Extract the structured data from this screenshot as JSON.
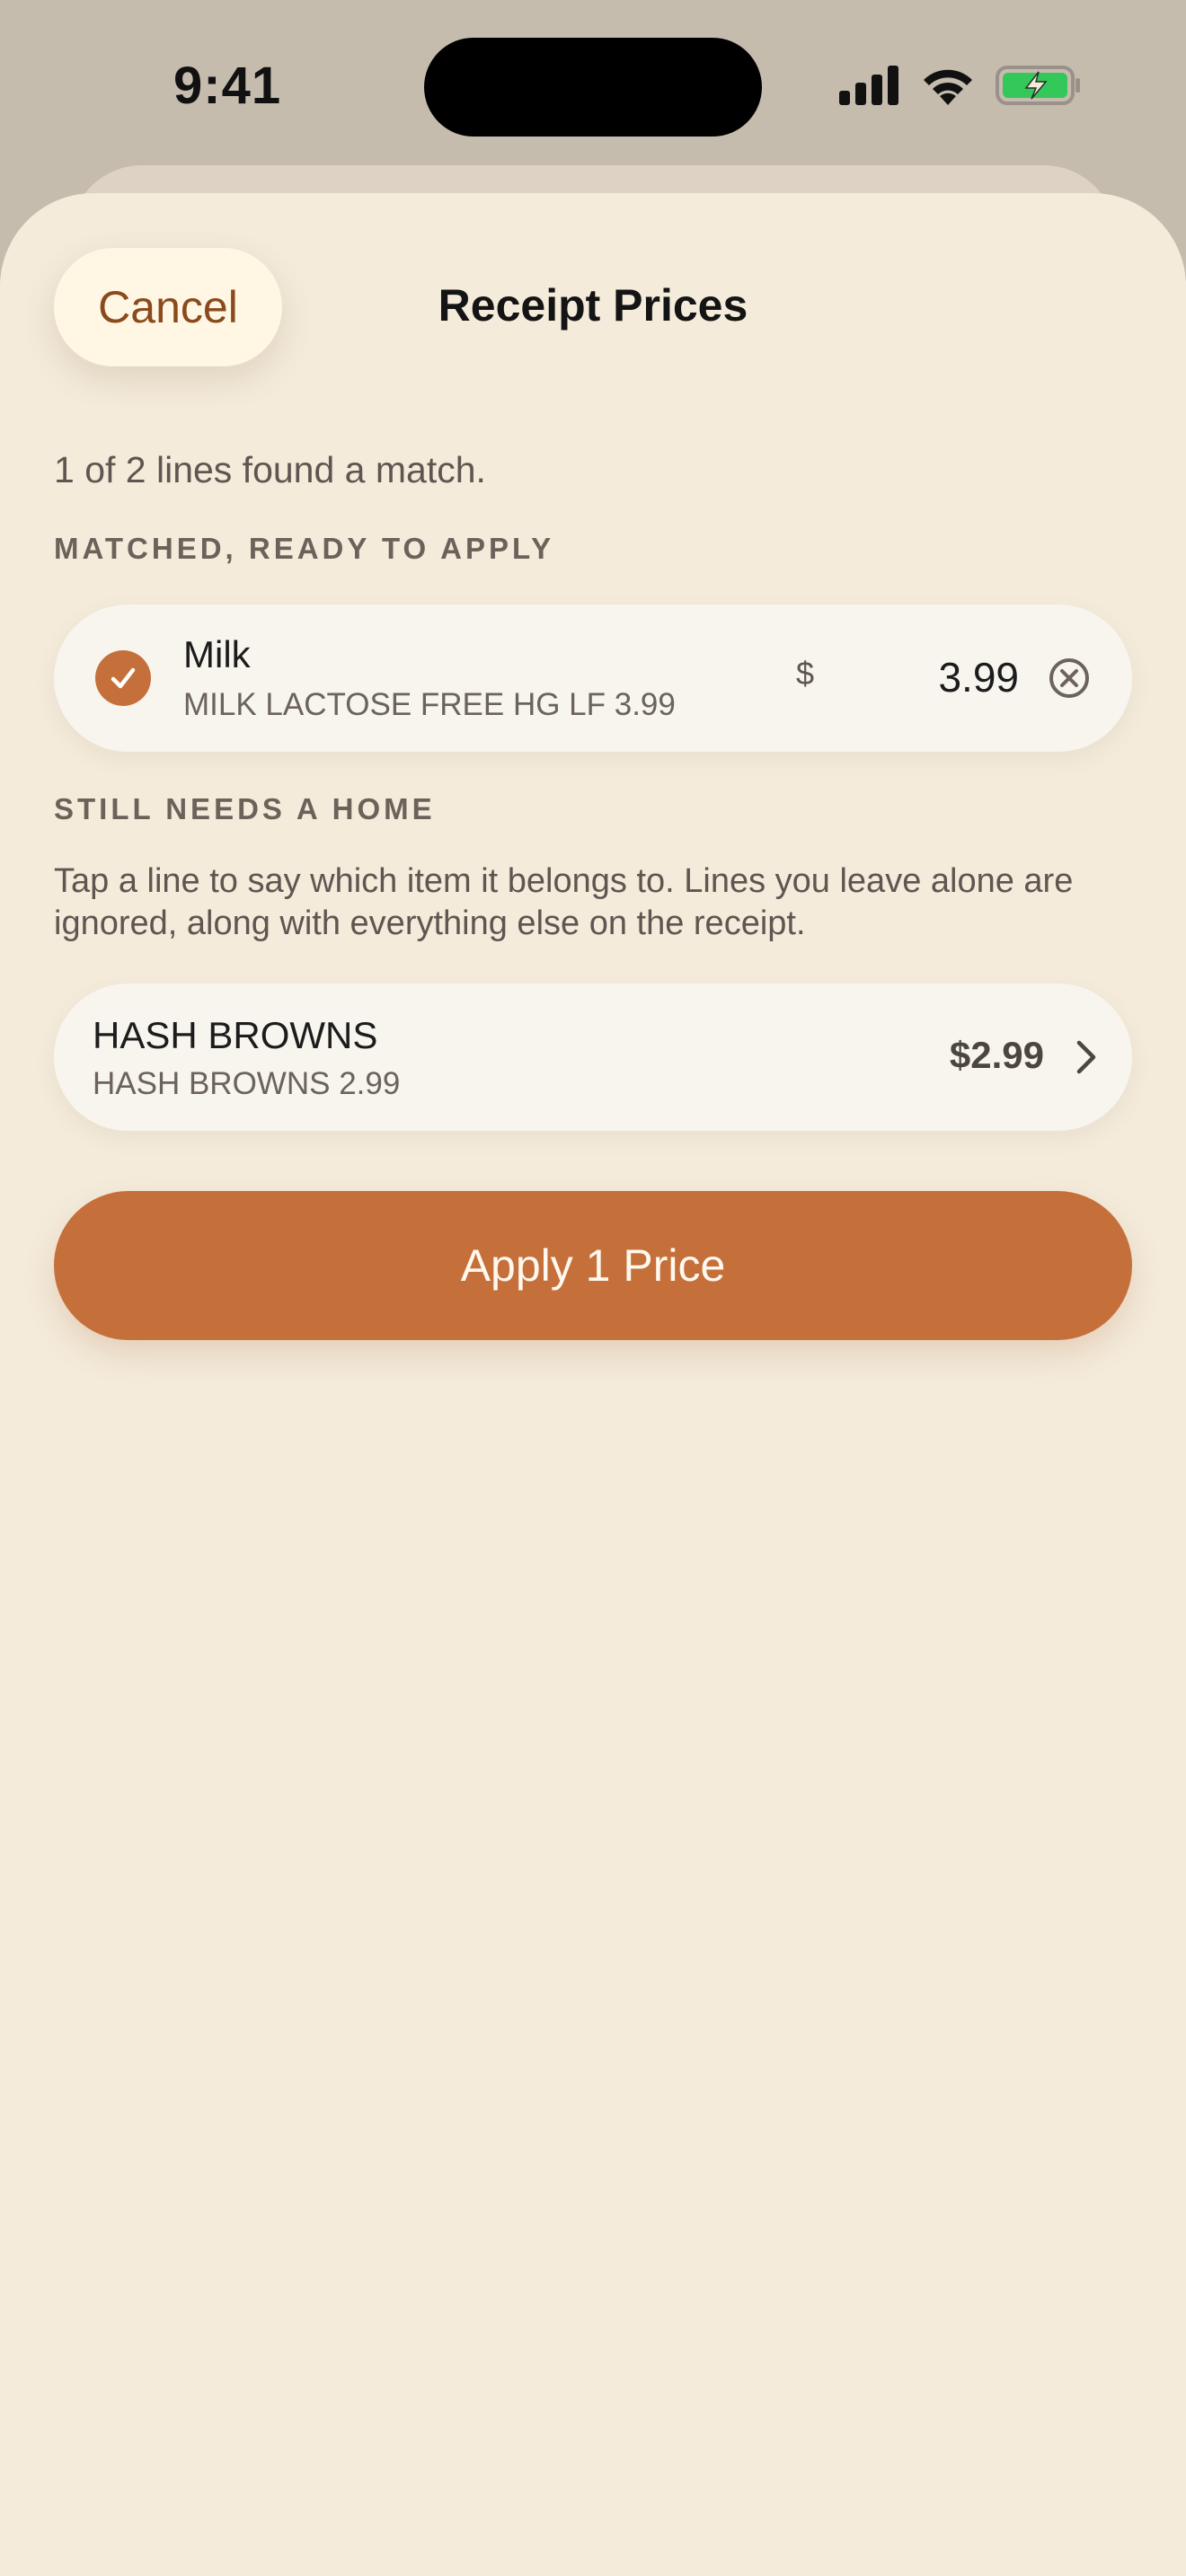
{
  "status_bar": {
    "time": "9:41",
    "icons": [
      "cellular-signal-icon",
      "wifi-icon",
      "battery-charging-icon"
    ]
  },
  "header": {
    "cancel_label": "Cancel",
    "title": "Receipt Prices"
  },
  "summary": "1 of 2 lines found a match.",
  "matched_section": {
    "label": "MATCHED, READY TO APPLY",
    "items": [
      {
        "name": "Milk",
        "receipt_line": "MILK LACTOSE FREE HG LF 3.99",
        "currency": "$",
        "price": "3.99",
        "checked": true
      }
    ]
  },
  "unmatched_section": {
    "label": "STILL NEEDS A HOME",
    "help_text": "Tap a line to say which item it belongs to. Lines you leave alone are ignored, along with everything else on the receipt.",
    "items": [
      {
        "name": "HASH BROWNS",
        "receipt_line": "HASH BROWNS 2.99",
        "price": "$2.99"
      }
    ]
  },
  "apply_button_label": "Apply 1 Price",
  "colors": {
    "accent": "#c5703a",
    "sheet_background": "#f4ebdb",
    "card_background": "#f8f4ee",
    "cancel_background": "#fff6e3",
    "battery_green": "#34c759"
  }
}
